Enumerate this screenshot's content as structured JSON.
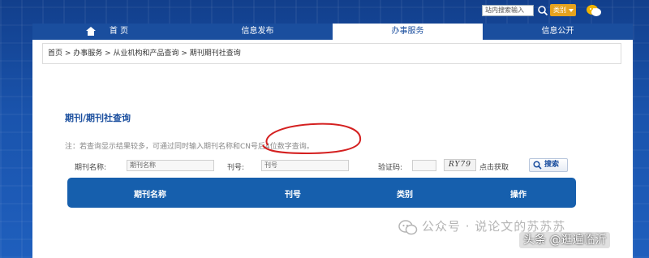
{
  "header": {
    "search_placeholder": "站内搜索输入",
    "category_select": "类别"
  },
  "nav": {
    "items": [
      {
        "label": "首  页"
      },
      {
        "label": "信息发布"
      },
      {
        "label": "办事服务"
      },
      {
        "label": "信息公开"
      }
    ],
    "active_index": 2
  },
  "breadcrumb": "首页 > 办事服务 > 从业机构和产品查询 > 期刊期刊社查询",
  "page_title": "期刊/期刊社查询",
  "note": "注：若查询显示结果较多，可通过同时输入期刊名称和CN号后4位数字查询。",
  "form": {
    "name_label": "期刊名称:",
    "name_placeholder": "期刊名称",
    "number_label": "刊号:",
    "number_placeholder": "刊号",
    "captcha_label": "验证码:",
    "captcha_value": "",
    "captcha_text": "RY79",
    "captcha_refresh": "点击获取",
    "search_button": "搜索"
  },
  "table": {
    "columns": [
      "期刊名称",
      "刊号",
      "类别",
      "操作"
    ]
  },
  "watermark": {
    "text": "公众号 · 说论文的苏苏苏",
    "source": "头条 @逛遍临沂"
  },
  "colors": {
    "primary": "#165fad",
    "nav_bg": "#1a4e9e",
    "accent": "#e5a21e",
    "annotation": "#d42020"
  }
}
